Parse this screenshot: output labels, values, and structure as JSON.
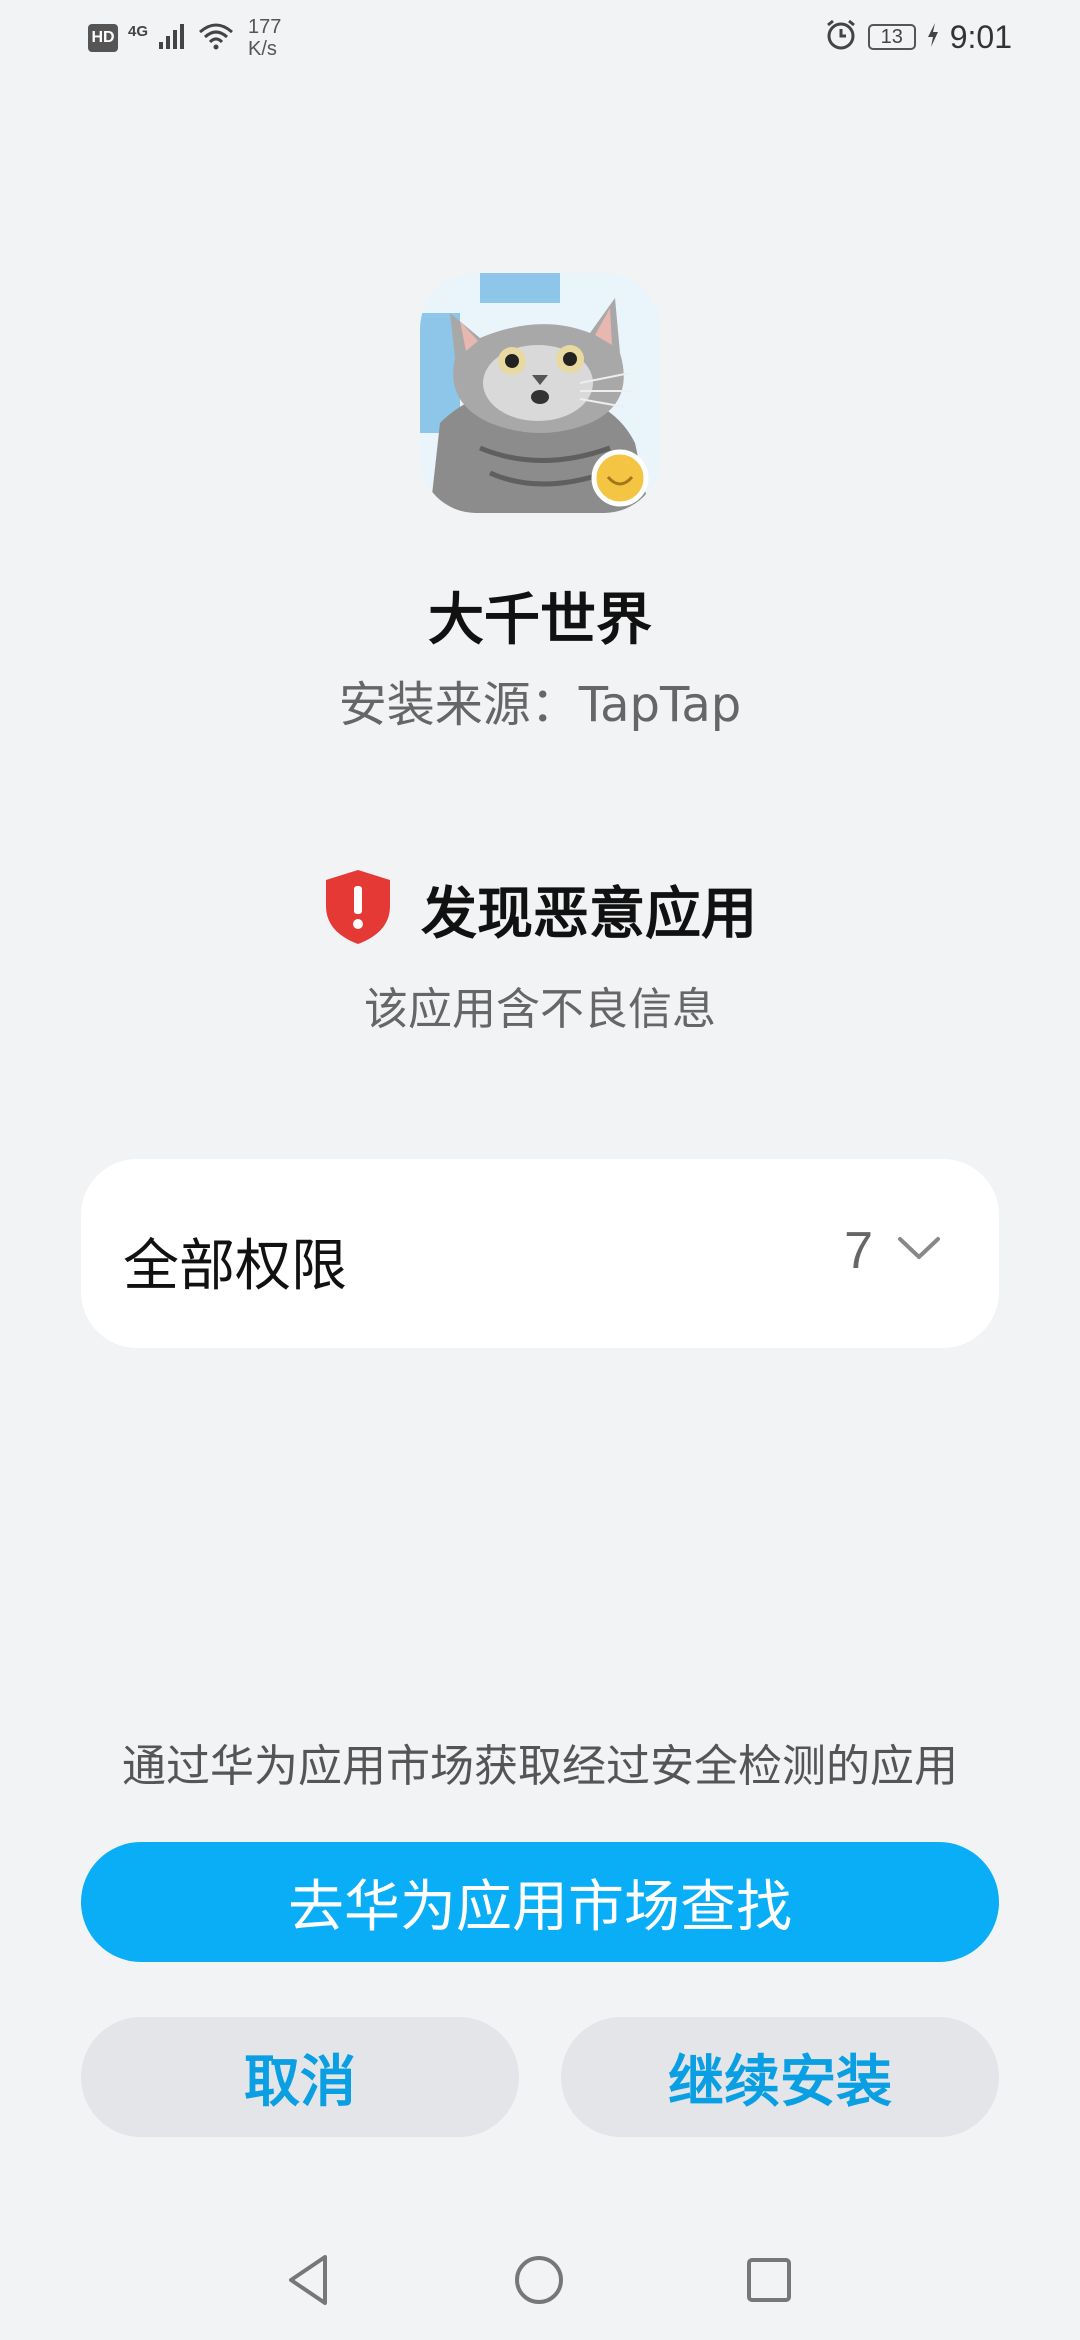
{
  "status_bar": {
    "hd_label": "HD",
    "network_label": "4G",
    "speed_value": "177",
    "speed_unit": "K/s",
    "battery_level": "13",
    "time": "9:01"
  },
  "app": {
    "name": "大千世界",
    "source": "安装来源：TapTap"
  },
  "warning": {
    "title": "发现恶意应用",
    "description": "该应用含不良信息",
    "accent_color": "#e53935"
  },
  "permissions": {
    "label": "全部权限",
    "count": "7"
  },
  "footer": {
    "hint": "通过华为应用市场获取经过安全检测的应用",
    "primary_button": "去华为应用市场查找",
    "cancel_button": "取消",
    "continue_button": "继续安装"
  },
  "colors": {
    "primary": "#0aaef7",
    "secondary_text": "#0a9fe3",
    "background": "#f1f3f5"
  }
}
